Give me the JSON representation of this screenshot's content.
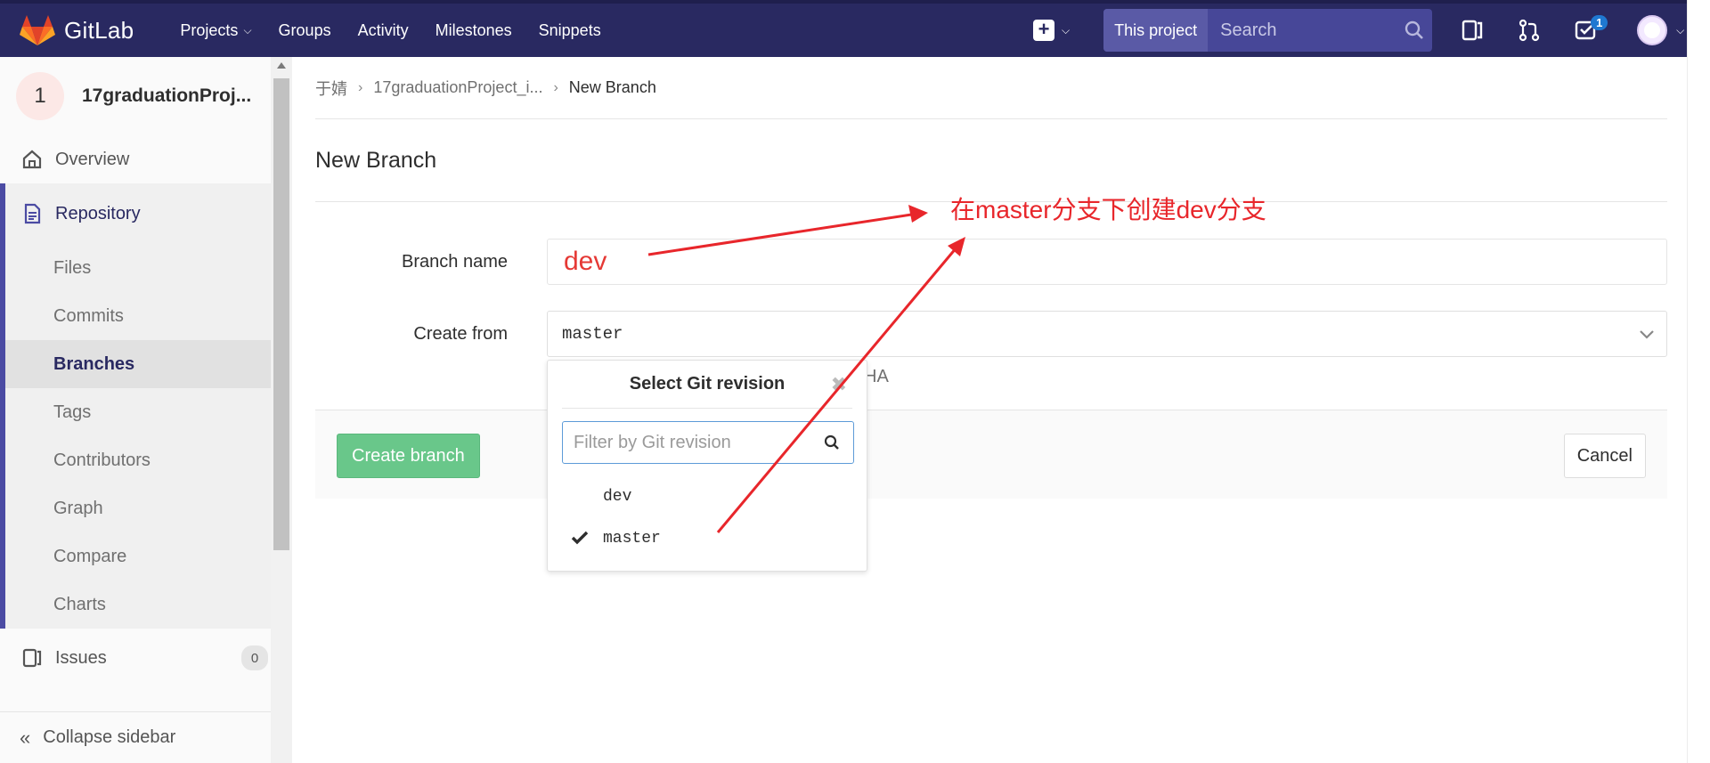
{
  "navbar": {
    "brand": "GitLab",
    "links": [
      "Projects",
      "Groups",
      "Activity",
      "Milestones",
      "Snippets"
    ],
    "search_scope": "This project",
    "search_placeholder": "Search",
    "todo_count": "1",
    "bg_color": "#292961"
  },
  "sidebar": {
    "project_initial": "1",
    "project_name": "17graduationProj...",
    "overview": "Overview",
    "repository": "Repository",
    "repo_items": [
      "Files",
      "Commits",
      "Branches",
      "Tags",
      "Contributors",
      "Graph",
      "Compare",
      "Charts"
    ],
    "active_item": "Branches",
    "issues_label": "Issues",
    "issues_count": "0",
    "collapse_label": "Collapse sidebar"
  },
  "breadcrumb": [
    "于婧",
    "17graduationProject_i...",
    "New Branch"
  ],
  "page_title": "New Branch",
  "form": {
    "branch_name_label": "Branch name",
    "branch_name_value": "dev",
    "create_from_label": "Create from",
    "create_from_value": "master",
    "hint_tail": "HA",
    "create_button": "Create branch",
    "cancel_button": "Cancel"
  },
  "dropdown": {
    "title": "Select Git revision",
    "filter_placeholder": "Filter by Git revision",
    "items": [
      "dev",
      "master"
    ],
    "selected": "master"
  },
  "annotation": {
    "text": "在master分支下创建dev分支",
    "color": "#e8262b"
  },
  "icons": [
    "gitlab-logo",
    "plus-icon",
    "search-icon",
    "sidebar-toggle-icon",
    "merge-request-icon",
    "todo-icon",
    "home-icon",
    "repository-icon",
    "issues-icon",
    "chevron-down-icon",
    "close-icon",
    "check-icon",
    "double-chevron-left-icon"
  ]
}
